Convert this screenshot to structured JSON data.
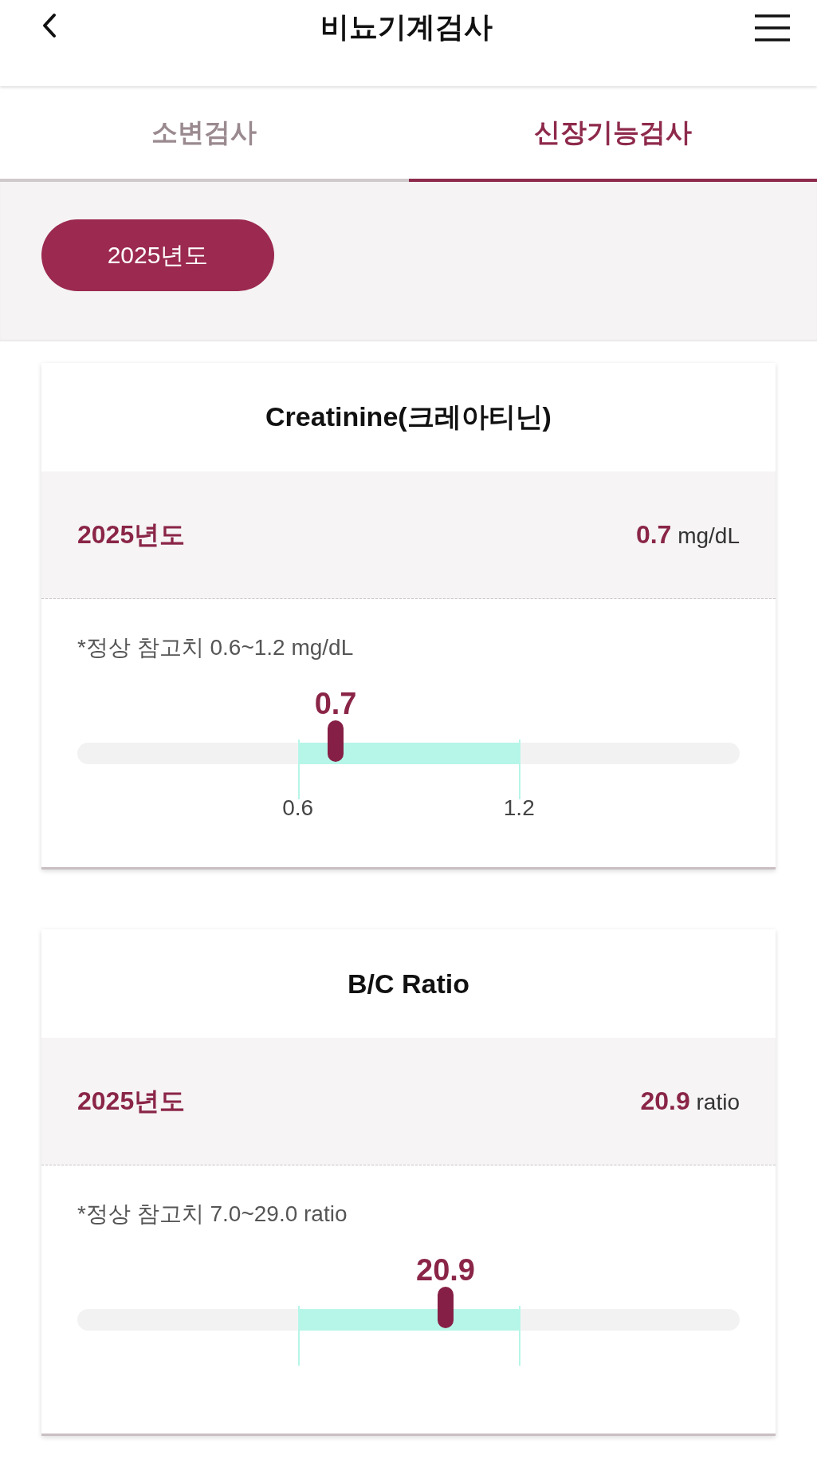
{
  "header": {
    "title": "비뇨기계검사"
  },
  "tabs": [
    {
      "label": "소변검사",
      "selected": false
    },
    {
      "label": "신장기능검사",
      "selected": true
    }
  ],
  "year_filter": {
    "label": "2025년도"
  },
  "cards": [
    {
      "title": "Creatinine(크레아티닌)",
      "year": "2025년도",
      "value": "0.7",
      "unit": "mg/dL",
      "reference": "*정상 참고치 0.6~1.2 mg/dL",
      "marker_value": "0.7",
      "level": 0.39,
      "range_low": "0.6",
      "range_high": "1.2"
    },
    {
      "title": "B/C Ratio",
      "year": "2025년도",
      "value": "20.9",
      "unit": "ratio",
      "reference": "*정상 참고치 7.0~29.0 ratio",
      "marker_value": "20.9",
      "level": 0.556
    }
  ]
}
